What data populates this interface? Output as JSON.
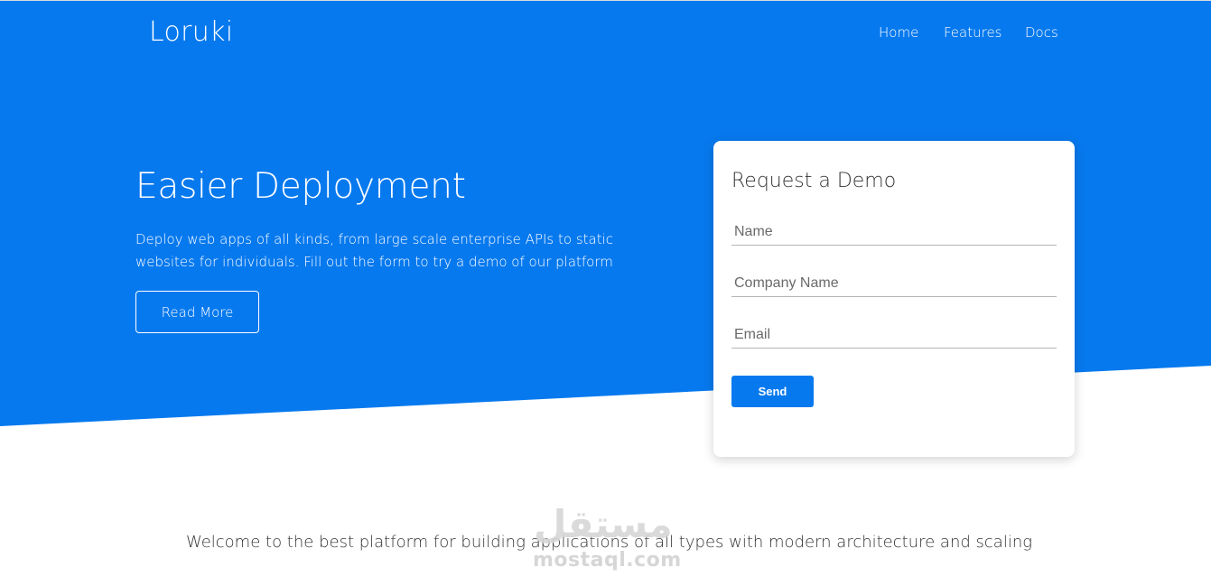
{
  "brand": {
    "logo": "Loruki"
  },
  "nav": {
    "items": [
      "Home",
      "Features",
      "Docs"
    ]
  },
  "hero": {
    "headline": "Easier Deployment",
    "subtext": "Deploy web apps of all kinds, from large scale enterprise APIs to static websites for individuals. Fill out the form to try a demo of our platform",
    "read_more_label": "Read More"
  },
  "demo_form": {
    "title": "Request a Demo",
    "name_placeholder": "Name",
    "company_placeholder": "Company Name",
    "email_placeholder": "Email",
    "send_label": "Send"
  },
  "welcome": {
    "text": "Welcome to the best platform for building applications of all types with modern architecture and scaling"
  },
  "watermark": {
    "arabic": "مستقل",
    "latin": "mostaql.com"
  },
  "colors": {
    "primary": "#0779ee",
    "text_dark": "#333333",
    "background": "#ffffff"
  }
}
